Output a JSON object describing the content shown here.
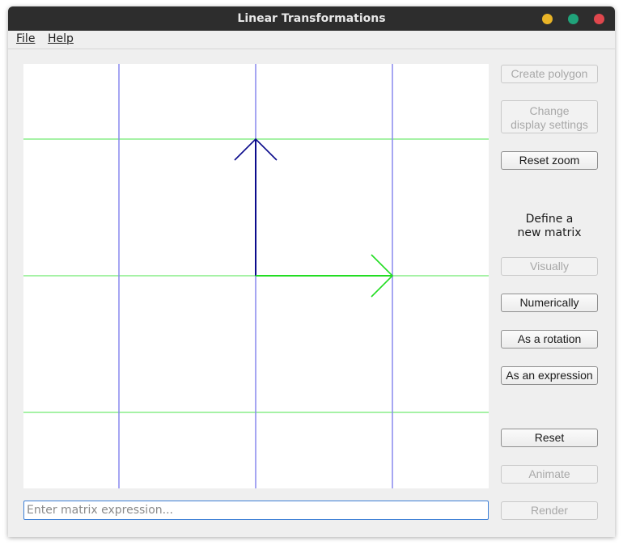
{
  "window": {
    "title": "Linear Transformations"
  },
  "menu": {
    "file": "File",
    "help": "Help"
  },
  "buttons": {
    "create_polygon": "Create polygon",
    "change_display": "Change\ndisplay settings",
    "reset_zoom": "Reset zoom",
    "visually": "Visually",
    "numerically": "Numerically",
    "as_rotation": "As a rotation",
    "as_expression": "As an expression",
    "reset": "Reset",
    "animate": "Animate",
    "render": "Render"
  },
  "define_label": "Define a\nnew matrix",
  "expression_input": {
    "placeholder": "Enter matrix expression...",
    "value": ""
  },
  "plot": {
    "basis_i": {
      "x": 1,
      "y": 0,
      "color": "#22dd22"
    },
    "basis_j": {
      "x": 0,
      "y": 1,
      "color": "#0b0b8c"
    },
    "grid_vertical_color": "#8888ee",
    "grid_horizontal_color": "#88ee88"
  }
}
